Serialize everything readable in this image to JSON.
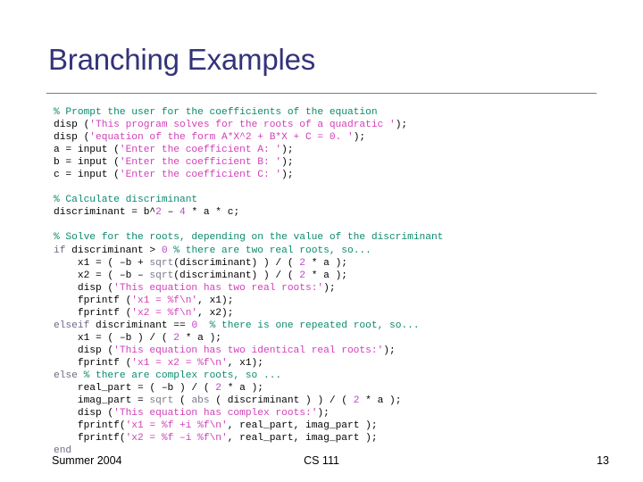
{
  "slide": {
    "title": "Branching Examples",
    "title_color": "#33337a",
    "rule_color": "#6b7d94",
    "background": "#ffffff"
  },
  "code": {
    "language": "MATLAB",
    "colors": {
      "comment": "#0b8a6e",
      "string": "#d13fb8",
      "number": "#bb44cc",
      "keyword": "#6a6a84",
      "function": "#7a7a8c",
      "plain": "#000000"
    },
    "lines": [
      [
        {
          "t": "comment",
          "s": "% Prompt the user for the coefficients of the equation"
        }
      ],
      [
        {
          "t": "plain",
          "s": "disp ("
        },
        {
          "t": "string",
          "s": "'This program solves for the roots of a quadratic '"
        },
        {
          "t": "plain",
          "s": ");"
        }
      ],
      [
        {
          "t": "plain",
          "s": "disp ("
        },
        {
          "t": "string",
          "s": "'equation of the form A*X^2 + B*X + C = 0. '"
        },
        {
          "t": "plain",
          "s": ");"
        }
      ],
      [
        {
          "t": "plain",
          "s": "a = input ("
        },
        {
          "t": "string",
          "s": "'Enter the coefficient A: '"
        },
        {
          "t": "plain",
          "s": ");"
        }
      ],
      [
        {
          "t": "plain",
          "s": "b = input ("
        },
        {
          "t": "string",
          "s": "'Enter the coefficient B: '"
        },
        {
          "t": "plain",
          "s": ");"
        }
      ],
      [
        {
          "t": "plain",
          "s": "c = input ("
        },
        {
          "t": "string",
          "s": "'Enter the coefficient C: '"
        },
        {
          "t": "plain",
          "s": ");"
        }
      ],
      [],
      [
        {
          "t": "comment",
          "s": "% Calculate discriminant"
        }
      ],
      [
        {
          "t": "plain",
          "s": "discriminant = b^"
        },
        {
          "t": "number",
          "s": "2"
        },
        {
          "t": "plain",
          "s": " – "
        },
        {
          "t": "number",
          "s": "4"
        },
        {
          "t": "plain",
          "s": " * a * c;"
        }
      ],
      [],
      [
        {
          "t": "comment",
          "s": "% Solve for the roots, depending on the value of the discriminant"
        }
      ],
      [
        {
          "t": "keyword",
          "s": "if"
        },
        {
          "t": "plain",
          "s": " discriminant > "
        },
        {
          "t": "number",
          "s": "0"
        },
        {
          "t": "plain",
          "s": " "
        },
        {
          "t": "comment",
          "s": "% there are two real roots, so..."
        }
      ],
      [
        {
          "t": "plain",
          "s": "    x1 = ( –b + "
        },
        {
          "t": "function",
          "s": "sqrt"
        },
        {
          "t": "plain",
          "s": "(discriminant) ) / ( "
        },
        {
          "t": "number",
          "s": "2"
        },
        {
          "t": "plain",
          "s": " * a );"
        }
      ],
      [
        {
          "t": "plain",
          "s": "    x2 = ( –b – "
        },
        {
          "t": "function",
          "s": "sqrt"
        },
        {
          "t": "plain",
          "s": "(discriminant) ) / ( "
        },
        {
          "t": "number",
          "s": "2"
        },
        {
          "t": "plain",
          "s": " * a );"
        }
      ],
      [
        {
          "t": "plain",
          "s": "    disp ("
        },
        {
          "t": "string",
          "s": "'This equation has two real roots:'"
        },
        {
          "t": "plain",
          "s": ");"
        }
      ],
      [
        {
          "t": "plain",
          "s": "    fprintf ("
        },
        {
          "t": "string",
          "s": "'x1 = %f\\n'"
        },
        {
          "t": "plain",
          "s": ", x1);"
        }
      ],
      [
        {
          "t": "plain",
          "s": "    fprintf ("
        },
        {
          "t": "string",
          "s": "'x2 = %f\\n'"
        },
        {
          "t": "plain",
          "s": ", x2);"
        }
      ],
      [
        {
          "t": "keyword",
          "s": "elseif"
        },
        {
          "t": "plain",
          "s": " discriminant == "
        },
        {
          "t": "number",
          "s": "0"
        },
        {
          "t": "plain",
          "s": "  "
        },
        {
          "t": "comment",
          "s": "% there is one repeated root, so..."
        }
      ],
      [
        {
          "t": "plain",
          "s": "    x1 = ( –b ) / ( "
        },
        {
          "t": "number",
          "s": "2"
        },
        {
          "t": "plain",
          "s": " * a );"
        }
      ],
      [
        {
          "t": "plain",
          "s": "    disp ("
        },
        {
          "t": "string",
          "s": "'This equation has two identical real roots:'"
        },
        {
          "t": "plain",
          "s": ");"
        }
      ],
      [
        {
          "t": "plain",
          "s": "    fprintf ("
        },
        {
          "t": "string",
          "s": "'x1 = x2 = %f\\n'"
        },
        {
          "t": "plain",
          "s": ", x1);"
        }
      ],
      [
        {
          "t": "keyword",
          "s": "else"
        },
        {
          "t": "plain",
          "s": " "
        },
        {
          "t": "comment",
          "s": "% there are complex roots, so ..."
        }
      ],
      [
        {
          "t": "plain",
          "s": "    real_part = ( –b ) / ( "
        },
        {
          "t": "number",
          "s": "2"
        },
        {
          "t": "plain",
          "s": " * a );"
        }
      ],
      [
        {
          "t": "plain",
          "s": "    imag_part = "
        },
        {
          "t": "function",
          "s": "sqrt"
        },
        {
          "t": "plain",
          "s": " ( "
        },
        {
          "t": "function",
          "s": "abs"
        },
        {
          "t": "plain",
          "s": " ( discriminant ) ) / ( "
        },
        {
          "t": "number",
          "s": "2"
        },
        {
          "t": "plain",
          "s": " * a );"
        }
      ],
      [
        {
          "t": "plain",
          "s": "    disp ("
        },
        {
          "t": "string",
          "s": "'This equation has complex roots:'"
        },
        {
          "t": "plain",
          "s": ");"
        }
      ],
      [
        {
          "t": "plain",
          "s": "    fprintf("
        },
        {
          "t": "string",
          "s": "'x1 = %f +i %f\\n'"
        },
        {
          "t": "plain",
          "s": ", real_part, imag_part );"
        }
      ],
      [
        {
          "t": "plain",
          "s": "    fprintf("
        },
        {
          "t": "string",
          "s": "'x2 = %f –i %f\\n'"
        },
        {
          "t": "plain",
          "s": ", real_part, imag_part );"
        }
      ],
      [
        {
          "t": "keyword",
          "s": "end"
        }
      ]
    ]
  },
  "footer": {
    "left": "Summer 2004",
    "center": "CS 111",
    "right": "13"
  }
}
